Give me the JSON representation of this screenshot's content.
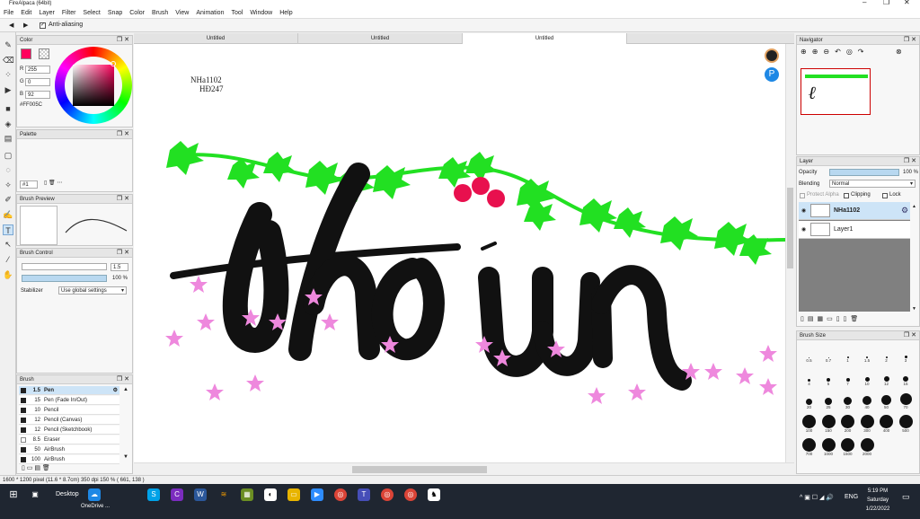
{
  "app": {
    "title": "FireAlpaca (64bit)",
    "window_controls": [
      "–",
      "❐",
      "✕"
    ]
  },
  "menu": [
    "File",
    "Edit",
    "Layer",
    "Filter",
    "Select",
    "Snap",
    "Color",
    "Brush",
    "View",
    "Animation",
    "Tool",
    "Window",
    "Help"
  ],
  "tool_options": {
    "prev": "◀",
    "next": "▶",
    "antialias_label": "Anti-aliasing",
    "antialias_checked": true
  },
  "tools": [
    "brush-icon",
    "eraser-icon",
    "dot-icon",
    "fill-icon",
    "rect-icon",
    "bucket-icon",
    "gradient-icon",
    "select-icon",
    "lasso-icon",
    "wand-icon",
    "pen-icon",
    "hand-icon",
    "text-icon",
    "move-icon",
    "eyedropper-icon",
    "pan-icon"
  ],
  "color_panel": {
    "title": "Color",
    "r_label": "R",
    "r_value": "255",
    "g_label": "G",
    "g_value": "0",
    "b_label": "B",
    "b_value": "92",
    "hex": "#FF005C",
    "fg_color": "#FF005C"
  },
  "palette_panel": {
    "title": "Palette",
    "selector": "#1"
  },
  "brush_preview_panel": {
    "title": "Brush Preview"
  },
  "brush_control_panel": {
    "title": "Brush Control",
    "size_value": "1.5",
    "opacity_value": "100 %",
    "stabilizer_label": "Stabilizer",
    "stabilizer_value": "Use global settings"
  },
  "brush_panel": {
    "title": "Brush",
    "items": [
      {
        "size": "1.5",
        "name": "Pen",
        "selected": true
      },
      {
        "size": "15",
        "name": "Pen (Fade In/Out)"
      },
      {
        "size": "10",
        "name": "Pencil"
      },
      {
        "size": "12",
        "name": "Pencil (Canvas)"
      },
      {
        "size": "12",
        "name": "Pencil (Sketchbook)"
      },
      {
        "size": "8.5",
        "name": "Eraser"
      },
      {
        "size": "50",
        "name": "AirBrush"
      },
      {
        "size": "100",
        "name": "AirBrush"
      }
    ]
  },
  "tabs": [
    {
      "label": "Untitled",
      "active": false
    },
    {
      "label": "Untitled",
      "active": false
    },
    {
      "label": "Untitled",
      "active": true
    }
  ],
  "canvas": {
    "caption_line1": "NHa1102",
    "caption_line2": "HĐ247",
    "artwork_letter_accent": "´",
    "berry_color": "#e8104e",
    "vine_color": "#22e022",
    "star_color": "#ee88dd"
  },
  "navigator_panel": {
    "title": "Navigator"
  },
  "layer_panel": {
    "title": "Layer",
    "opacity_label": "Opacity",
    "opacity_value": "100 %",
    "blending_label": "Blending",
    "blending_value": "Normal",
    "protect_alpha_label": "Protect Alpha",
    "clipping_label": "Clipping",
    "lock_label": "Lock",
    "layers": [
      {
        "name": "NHa1102",
        "selected": true
      },
      {
        "name": "Layer1",
        "selected": false
      }
    ]
  },
  "brush_size_panel": {
    "title": "Brush Size",
    "sizes": [
      "0.5",
      "0.7",
      "1",
      "1.5",
      "2",
      "3",
      "4",
      "5",
      "7",
      "10",
      "12",
      "15",
      "20",
      "25",
      "30",
      "40",
      "50",
      "70",
      "100",
      "150",
      "200",
      "300",
      "400",
      "500",
      "700",
      "1000",
      "1500",
      "2000"
    ]
  },
  "status_bar": {
    "text": "1600 * 1200 pixel  (11.6 * 8.7cm)  350 dpi  150 %  ( 661, 138 )"
  },
  "taskbar": {
    "desktop_label": "Desktop",
    "onedrive_label": "OneDrive ...",
    "language": "ENG",
    "time": "5:19 PM",
    "day": "Saturday",
    "date": "1/22/2022"
  }
}
